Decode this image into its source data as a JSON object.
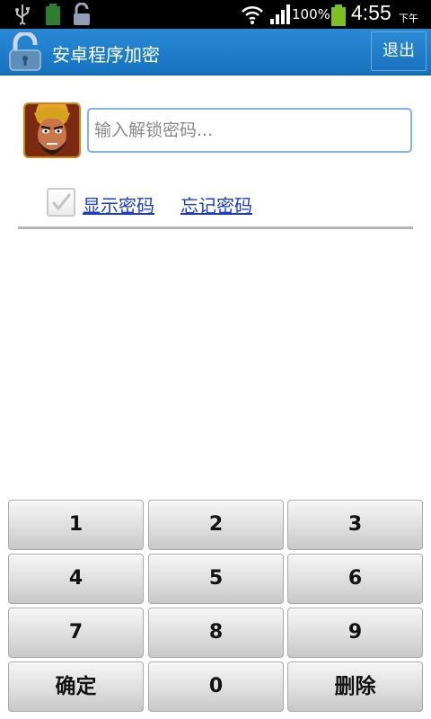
{
  "status_bar": {
    "battery_percent": "100%",
    "time": "4:55",
    "ampm": "下午",
    "icons": [
      "usb-icon",
      "battery-small-icon",
      "unlock-icon",
      "wifi-icon",
      "signal-icon",
      "battery-icon"
    ]
  },
  "title_bar": {
    "title": "安卓程序加密",
    "exit_label": "退出",
    "color": "#1a7ac8"
  },
  "unlock_form": {
    "password_placeholder": "输入解锁密码...",
    "show_password_label": "显示密码",
    "forgot_password_label": "忘记密码",
    "show_password_checked": true
  },
  "keypad": {
    "keys": [
      "1",
      "2",
      "3",
      "4",
      "5",
      "6",
      "7",
      "8",
      "9",
      "确定",
      "0",
      "删除"
    ]
  }
}
